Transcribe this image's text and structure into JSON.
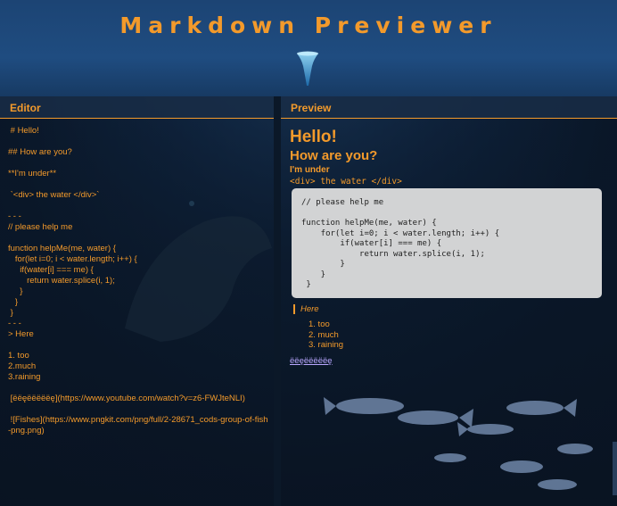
{
  "app": {
    "title": "Markdown Previewer"
  },
  "editor": {
    "label": "Editor",
    "content": " # Hello!\n\n## How are you?\n\n**I'm under**\n\n `<div> the water </div>`\n\n- - -\n// please help me\n\nfunction helpMe(me, water) {\n   for(let i=0; i < water.length; i++) {\n     if(water[i] === me) {\n        return water.splice(i, 1);\n     }\n   }\n }\n- - -\n> Here\n\n1. too\n2.much\n3.raining\n\n [ëëęëëëëëę](https://www.youtube.com/watch?v=z6-FWJteNLI)\n\n ![Fishes](https://www.pngkit.com/png/full/2-28671_cods-group-of-fish-png.png)"
  },
  "preview": {
    "label": "Preview",
    "h1": "Hello!",
    "h2": "How are you?",
    "strong": "I'm under",
    "inline_code": "<div> the water </div>",
    "code_block": "// please help me\n\nfunction helpMe(me, water) {\n    for(let i=0; i < water.length; i++) {\n        if(water[i] === me) {\n            return water.splice(i, 1);\n        }\n    }\n }",
    "blockquote": "Here",
    "list": [
      "1. too",
      "2. much",
      "3. raining"
    ],
    "link_text": "ëëęëëëëëę"
  },
  "colors": {
    "accent": "#f39a2b",
    "link": "#b9a7ff",
    "code_bg": "#d2d3d4"
  }
}
